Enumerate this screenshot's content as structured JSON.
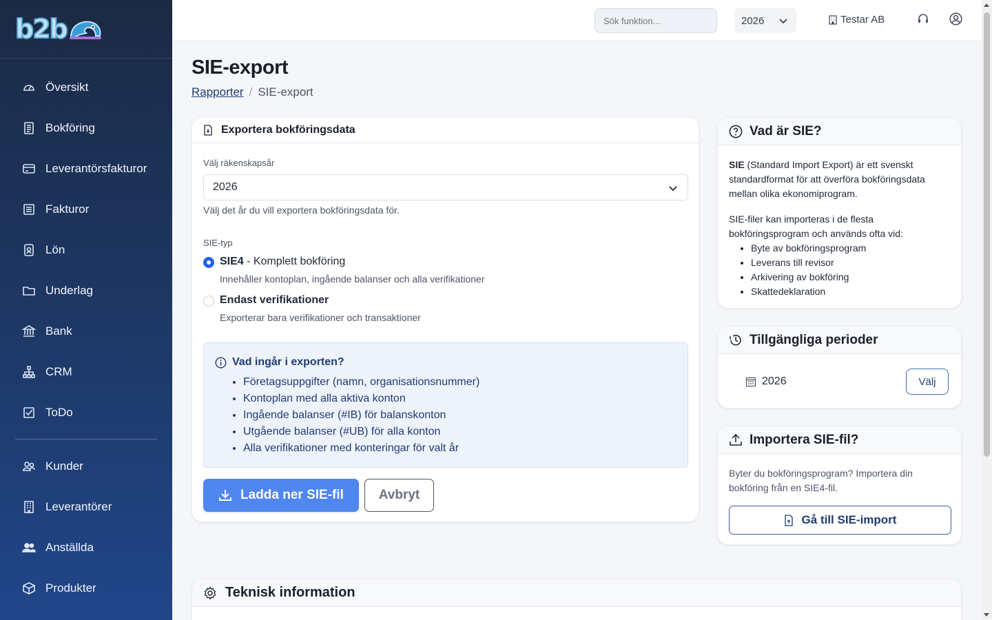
{
  "brand": {
    "logo_text": "b2b"
  },
  "sidebar": {
    "items": [
      {
        "label": "Översikt",
        "icon": "gauge-icon"
      },
      {
        "label": "Bokföring",
        "icon": "ledger-icon"
      },
      {
        "label": "Leverantörsfakturor",
        "icon": "credit-card-icon"
      },
      {
        "label": "Fakturor",
        "icon": "invoice-icon"
      },
      {
        "label": "Lön",
        "icon": "id-badge-icon"
      },
      {
        "label": "Underlag",
        "icon": "folder-icon"
      },
      {
        "label": "Bank",
        "icon": "bank-icon"
      },
      {
        "label": "CRM",
        "icon": "sitemap-icon"
      },
      {
        "label": "ToDo",
        "icon": "checkbox-icon"
      }
    ],
    "items2": [
      {
        "label": "Kunder",
        "icon": "users-icon"
      },
      {
        "label": "Leverantörer",
        "icon": "building-icon"
      },
      {
        "label": "Anställda",
        "icon": "people-icon"
      },
      {
        "label": "Produkter",
        "icon": "box-icon"
      }
    ]
  },
  "topbar": {
    "search_placeholder": "Sök funktion...",
    "year": "2026",
    "company": "Testar AB"
  },
  "page": {
    "title": "SIE-export",
    "breadcrumb_parent": "Rapporter",
    "breadcrumb_current": "SIE-export"
  },
  "export": {
    "heading": "Exportera bokföringsdata",
    "year_label": "Välj räkenskapsår",
    "year_value": "2026",
    "year_hint": "Välj det år du vill exportera bokföringsdata för.",
    "type_label": "SIE-typ",
    "option1_bold": "SIE4",
    "option1_rest": " - Komplett bokföring",
    "option1_desc": "Innehåller kontoplan, ingående balanser och alla verifikationer",
    "option2_label": "Endast verifikationer",
    "option2_desc": "Exporterar bara verifikationer och transaktioner",
    "info_title": "Vad ingår i exporten?",
    "info_items": [
      "Företagsuppgifter (namn, organisationsnummer)",
      "Kontoplan med alla aktiva konton",
      "Ingående balanser (#IB) för balanskonton",
      "Utgående balanser (#UB) för alla konton",
      "Alla verifikationer med konteringar för valt år"
    ],
    "download_label": "Ladda ner SIE-fil",
    "cancel_label": "Avbryt"
  },
  "sie_info": {
    "heading": "Vad är SIE?",
    "p1_bold": "SIE",
    "p1_rest": " (Standard Import Export) är ett svenskt standardformat för att överföra bokföringsdata mellan olika ekonomiprogram.",
    "p2": "SIE-filer kan importeras i de flesta bokföringsprogram och används ofta vid:",
    "items": [
      "Byte av bokföringsprogram",
      "Leverans till revisor",
      "Arkivering av bokföring",
      "Skattedeklaration"
    ]
  },
  "periods": {
    "heading": "Tillgängliga perioder",
    "year": "2026",
    "select_label": "Välj"
  },
  "import": {
    "heading": "Importera SIE-fil?",
    "text": "Byter du bokföringsprogram? Importera din bokföring från en SIE4-fil.",
    "button_label": "Gå till SIE-import"
  },
  "tech": {
    "heading": "Teknisk information"
  },
  "colors": {
    "primary": "#4f86f0",
    "sidebar": "#1e3a6b",
    "accent_text": "#1f3b73"
  }
}
